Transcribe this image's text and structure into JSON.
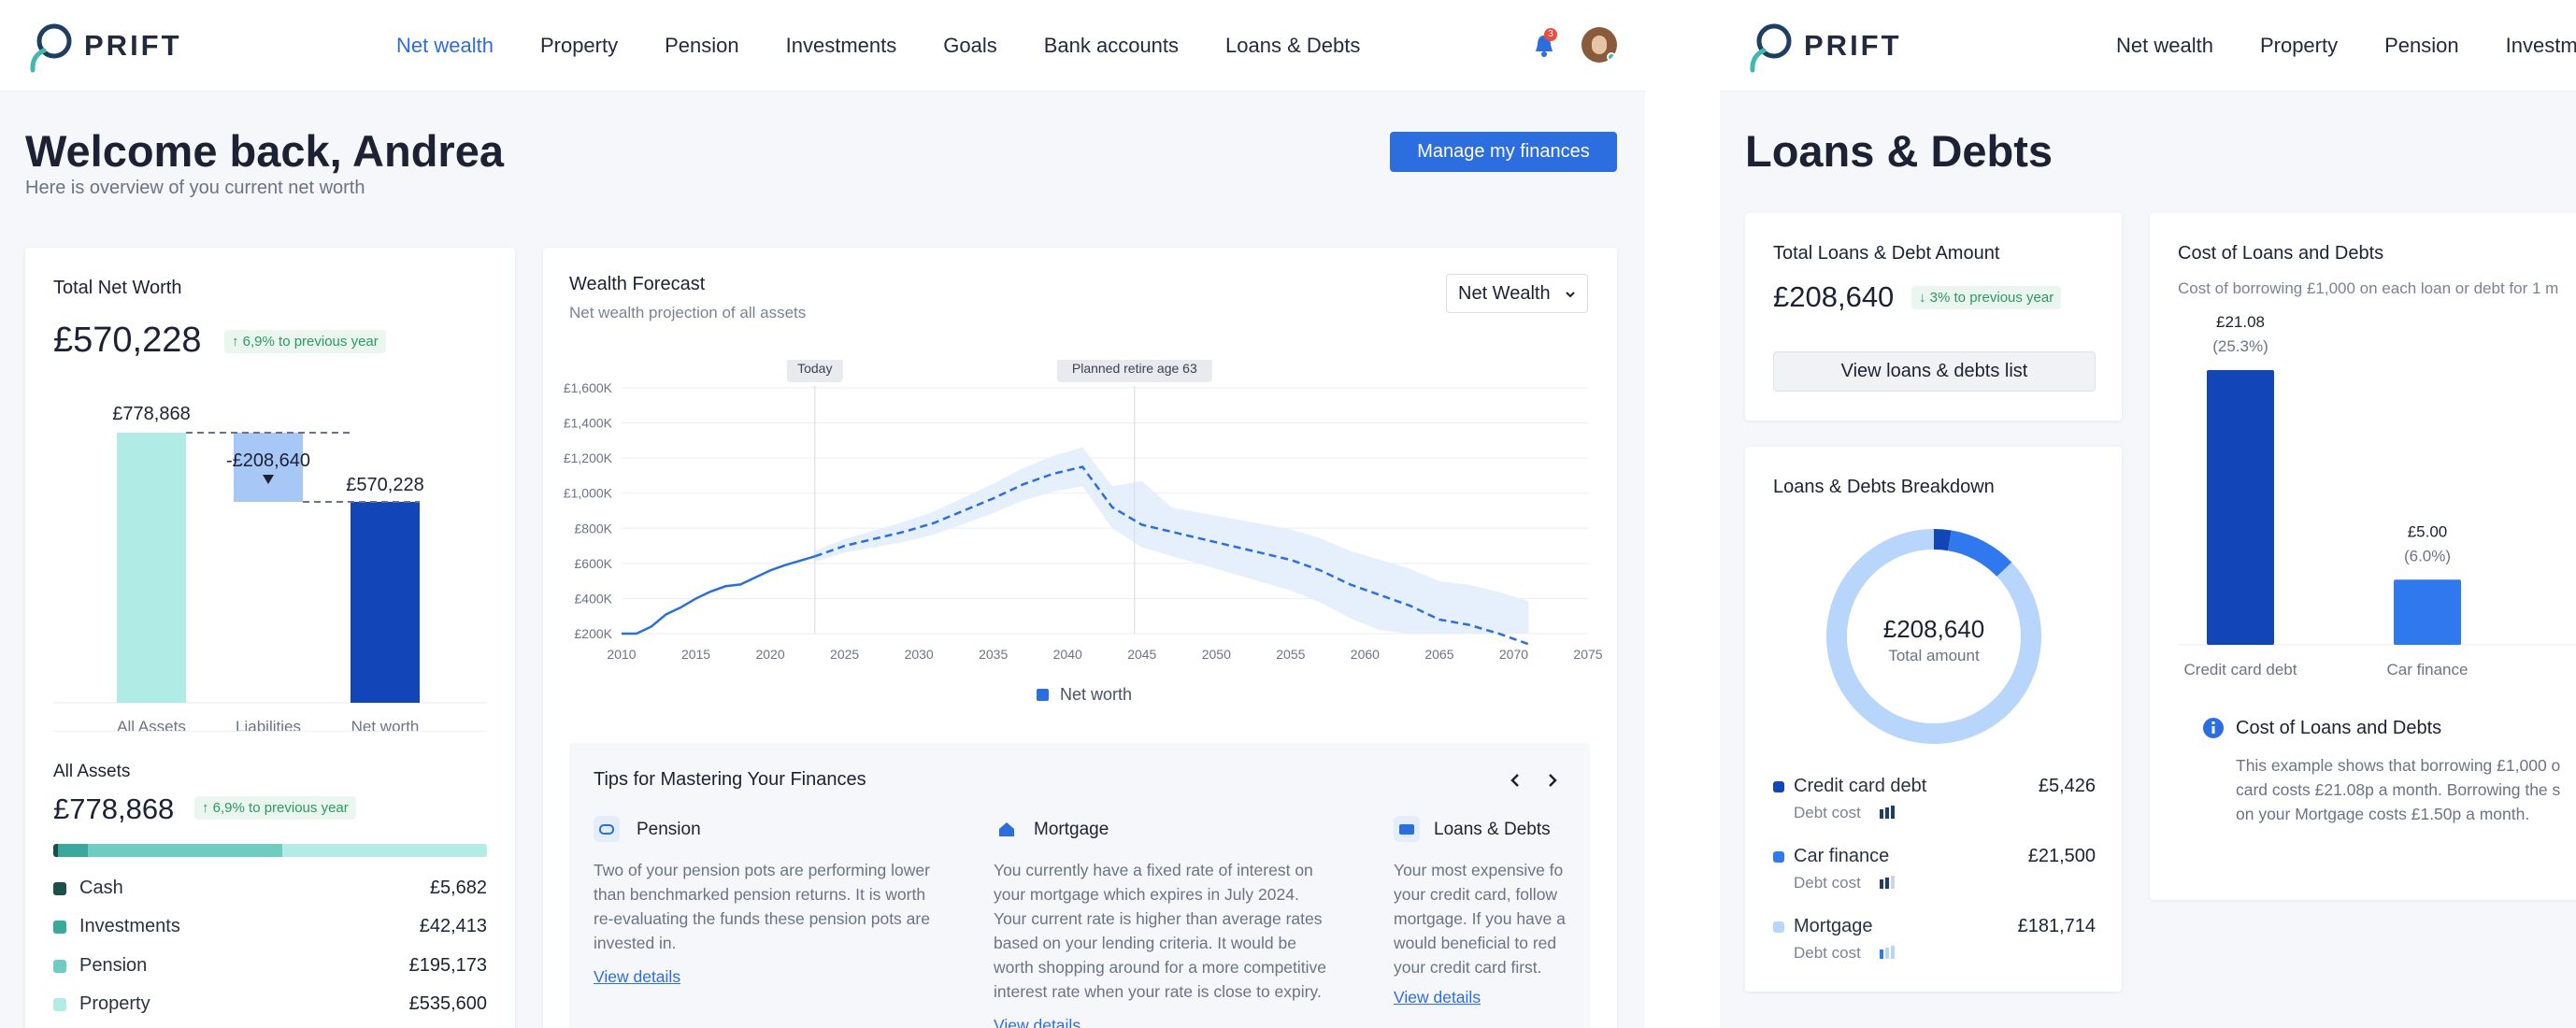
{
  "screen1": {
    "logo_text": "PRIFT",
    "nav": [
      "Net wealth",
      "Property",
      "Pension",
      "Investments",
      "Goals",
      "Bank accounts",
      "Loans & Debts"
    ],
    "notification_count": "3",
    "welcome_title": "Welcome back, Andrea",
    "welcome_sub": "Here is overview of you current net worth",
    "manage_button": "Manage my finances",
    "net_worth_card": {
      "title": "Total Net Worth",
      "amount": "£570,228",
      "badge": "↑ 6,9% to previous year",
      "bar_labels": {
        "assets": "£778,868",
        "liabilities": "-£208,640",
        "net": "£570,228"
      },
      "categories": [
        "All Assets",
        "Liabilities",
        "Net worth"
      ]
    },
    "all_assets": {
      "title": "All Assets",
      "amount": "£778,868",
      "badge": "↑ 6,9% to previous year",
      "items": [
        {
          "label": "Cash",
          "value": "£5,682",
          "color": "#1d4f4a"
        },
        {
          "label": "Investments",
          "value": "£42,413",
          "color": "#3aa89a"
        },
        {
          "label": "Pension",
          "value": "£195,173",
          "color": "#6ccdc0"
        },
        {
          "label": "Property",
          "value": "£535,600",
          "color": "#b3ece5"
        }
      ]
    },
    "forecast": {
      "title": "Wealth Forecast",
      "subtitle": "Net wealth projection of all assets",
      "dropdown": "Net Wealth",
      "marker_today": "Today",
      "marker_retire": "Planned retire age 63",
      "legend": "Net worth"
    },
    "tips": {
      "title": "Tips for Mastering Your Finances",
      "items": [
        {
          "title": "Pension",
          "text": [
            "Two of your pension pots are performing lower",
            "than benchmarked pension returns. It is worth",
            "re-evaluating the funds these pension pots are",
            "invested in."
          ],
          "link": "View details"
        },
        {
          "title": "Mortgage",
          "text": [
            "You currently have a fixed rate of interest on",
            "your mortgage which expires in July 2024.",
            "Your current rate is higher than average rates",
            "based on your lending criteria. It would be",
            "worth shopping around for a more competitive",
            "interest rate when your rate is close to expiry."
          ],
          "link": "View details"
        },
        {
          "title": "Loans & Debts",
          "text": [
            "Your most expensive fo",
            "your credit card, follow",
            "mortgage. If you have a",
            "would beneficial to red",
            "your credit card first."
          ],
          "link": "View details"
        }
      ]
    }
  },
  "screen2": {
    "logo_text": "PRIFT",
    "nav": [
      "Net wealth",
      "Property",
      "Pension",
      "Investme"
    ],
    "page_title": "Loans & Debts",
    "total_card": {
      "title": "Total Loans & Debt Amount",
      "amount": "£208,640",
      "badge": "↓ 3% to previous year",
      "button": "View loans & debts list"
    },
    "breakdown": {
      "title": "Loans & Debts Breakdown",
      "center_amount": "£208,640",
      "center_label": "Total amount",
      "debt_cost_label": "Debt cost",
      "items": [
        {
          "label": "Credit card debt",
          "value": "£5,426",
          "color": "#1245b8",
          "cost_level": 3
        },
        {
          "label": "Car finance",
          "value": "£21,500",
          "color": "#2f78ee",
          "cost_level": 2
        },
        {
          "label": "Mortgage",
          "value": "£181,714",
          "color": "#b8d6fb",
          "cost_level": 1
        }
      ]
    },
    "cost_card": {
      "title": "Cost of Loans and Debts",
      "subtitle": "Cost of borrowing £1,000 on each loan or debt for 1 m",
      "info_title": "Cost of Loans and Debts",
      "info_text": [
        "This example shows that borrowing £1,000 o",
        "card costs £21.08p a month. Borrowing the s",
        "on your Mortgage costs £1.50p a month."
      ]
    }
  },
  "chart_data": [
    {
      "type": "bar",
      "title": "Total Net Worth",
      "categories": [
        "All Assets",
        "Liabilities",
        "Net worth"
      ],
      "values": [
        778868,
        -208640,
        570228
      ],
      "data_labels": [
        "£778,868",
        "-£208,640",
        "£570,228"
      ]
    },
    {
      "type": "line",
      "title": "Wealth Forecast",
      "series": [
        {
          "name": "Net worth",
          "values": [
            200,
            200,
            240,
            310,
            350,
            400,
            440,
            470,
            480,
            520,
            560,
            590,
            640,
            700,
            740,
            780,
            830,
            900,
            970,
            1050,
            1110,
            1150,
            920,
            820,
            780,
            740,
            700,
            660,
            620,
            560,
            480,
            420,
            360,
            280,
            250,
            200,
            140
          ]
        }
      ],
      "x": [
        2010,
        2011,
        2012,
        2013,
        2014,
        2015,
        2016,
        2017,
        2018,
        2019,
        2020,
        2021,
        2023,
        2025,
        2027,
        2029,
        2031,
        2033,
        2035,
        2037,
        2039,
        2041,
        2043,
        2045,
        2047,
        2049,
        2051,
        2053,
        2055,
        2057,
        2059,
        2061,
        2063,
        2065,
        2067,
        2069,
        2071
      ],
      "x_ticks": [
        "2010",
        "2015",
        "2020",
        "2025",
        "2030",
        "2035",
        "2040",
        "2045",
        "2050",
        "2055",
        "2060",
        "2065",
        "2070",
        "2075"
      ],
      "y_ticks": [
        "£200K",
        "£400K",
        "£600K",
        "£800K",
        "£1,000K",
        "£1,200K",
        "£1,400K",
        "£1,600K"
      ],
      "ylim": [
        200,
        1600
      ],
      "xlim": [
        2010,
        2075
      ],
      "grid": true,
      "legend_position": "bottom"
    },
    {
      "type": "pie",
      "title": "Loans & Debts Breakdown",
      "categories": [
        "Credit card debt",
        "Car finance",
        "Mortgage"
      ],
      "values": [
        5426,
        21500,
        181714
      ]
    },
    {
      "type": "bar",
      "title": "Cost of Loans and Debts",
      "categories": [
        "Credit card debt",
        "Car finance"
      ],
      "values": [
        21.08,
        5.0
      ],
      "data_labels": [
        "£21.08",
        "£5.00"
      ],
      "percent_labels": [
        "(25.3%)",
        "(6.0%)"
      ]
    }
  ]
}
